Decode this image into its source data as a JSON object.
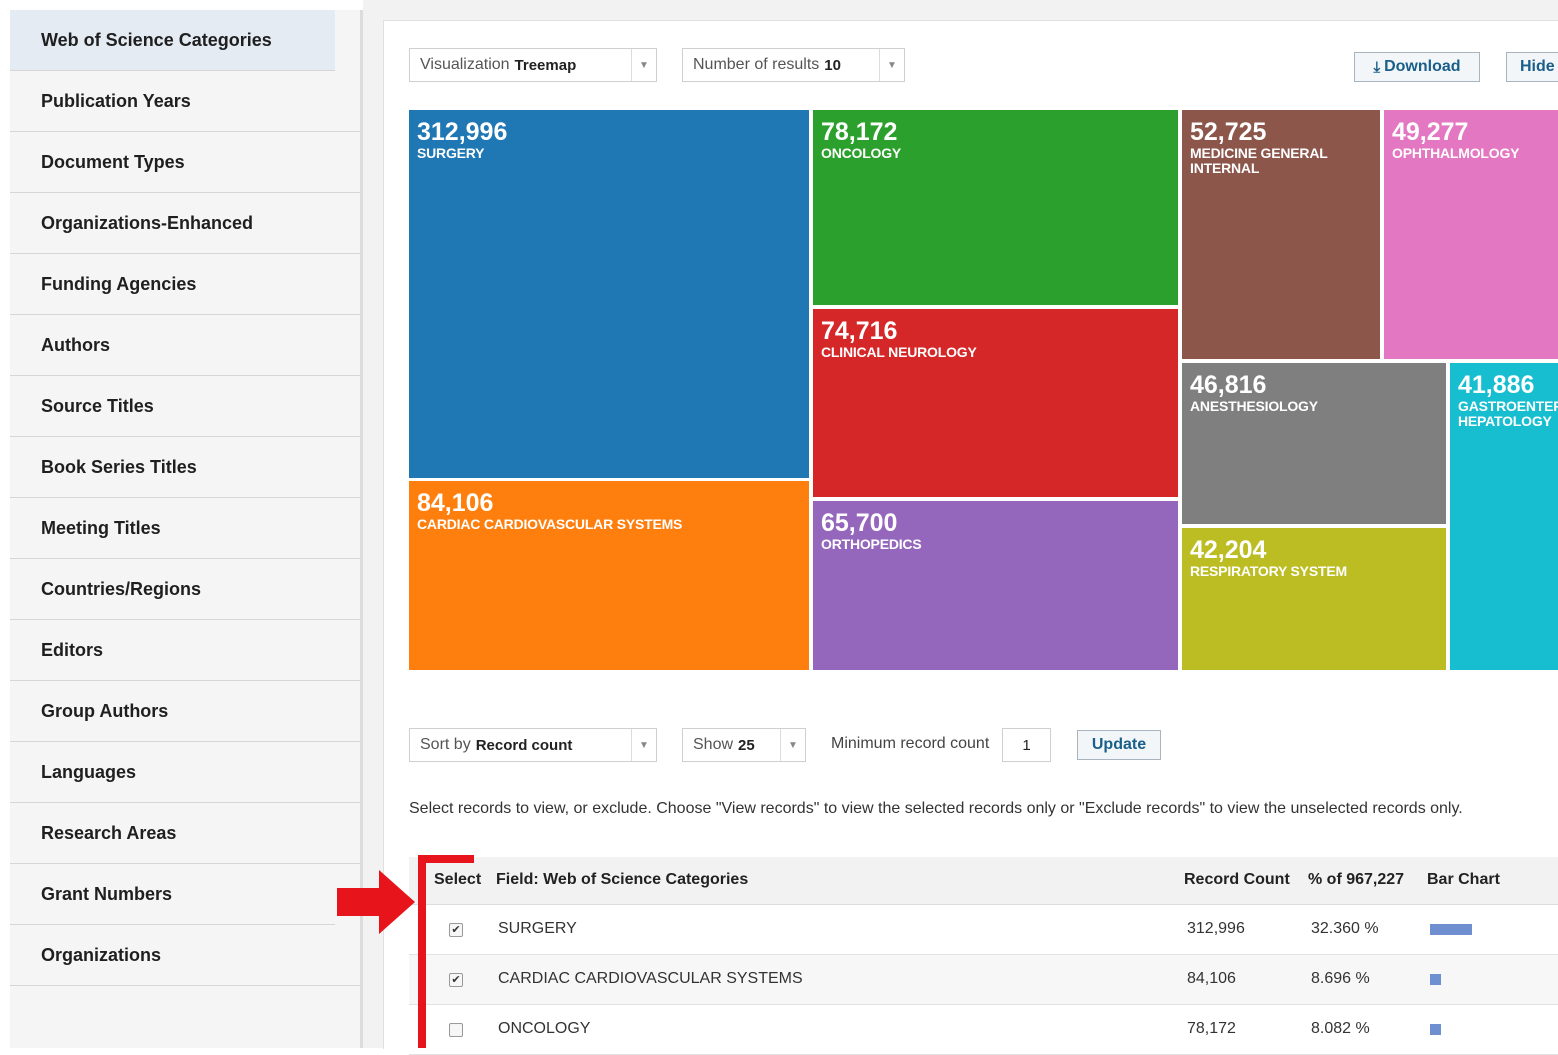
{
  "sidebar": {
    "items": [
      {
        "label": "Web of Science Categories"
      },
      {
        "label": "Publication Years"
      },
      {
        "label": "Document Types"
      },
      {
        "label": "Organizations-Enhanced"
      },
      {
        "label": "Funding Agencies"
      },
      {
        "label": "Authors"
      },
      {
        "label": "Source Titles"
      },
      {
        "label": "Book Series Titles"
      },
      {
        "label": "Meeting Titles"
      },
      {
        "label": "Countries/Regions"
      },
      {
        "label": "Editors"
      },
      {
        "label": "Group Authors"
      },
      {
        "label": "Languages"
      },
      {
        "label": "Research Areas"
      },
      {
        "label": "Grant Numbers"
      },
      {
        "label": "Organizations"
      }
    ]
  },
  "toolbar": {
    "visualization_label": "Visualization",
    "visualization_value": "Treemap",
    "results_label": "Number of results",
    "results_value": "10",
    "download_label": "Download",
    "hide_label": "Hide"
  },
  "chart_data": {
    "type": "treemap",
    "items": [
      {
        "value": 312996,
        "display": "312,996",
        "label": "SURGERY",
        "color": "#1f77b4"
      },
      {
        "value": 84106,
        "display": "84,106",
        "label": "CARDIAC CARDIOVASCULAR SYSTEMS",
        "color": "#ff7f0e"
      },
      {
        "value": 78172,
        "display": "78,172",
        "label": "ONCOLOGY",
        "color": "#2ca02c"
      },
      {
        "value": 74716,
        "display": "74,716",
        "label": "CLINICAL NEUROLOGY",
        "color": "#d62728"
      },
      {
        "value": 65700,
        "display": "65,700",
        "label": "ORTHOPEDICS",
        "color": "#9467bd"
      },
      {
        "value": 52725,
        "display": "52,725",
        "label": "MEDICINE GENERAL INTERNAL",
        "color": "#8c564b"
      },
      {
        "value": 49277,
        "display": "49,277",
        "label": "OPHTHALMOLOGY",
        "color": "#e377c2"
      },
      {
        "value": 46816,
        "display": "46,816",
        "label": "ANESTHESIOLOGY",
        "color": "#7f7f7f"
      },
      {
        "value": 42204,
        "display": "42,204",
        "label": "RESPIRATORY SYSTEM",
        "color": "#bcbd22"
      },
      {
        "value": 41886,
        "display": "41,886",
        "label": "GASTROENTEROLOGY HEPATOLOGY",
        "shown_label": "GASTROENTER HEPATOLOGY",
        "color": "#17becf"
      }
    ]
  },
  "controls": {
    "sort_label": "Sort by",
    "sort_value": "Record count",
    "show_label": "Show",
    "show_value": "25",
    "min_count_label": "Minimum record count",
    "min_count_value": "1",
    "update_label": "Update"
  },
  "instructions": "Select records to view, or exclude. Choose \"View records\" to view the selected records only or \"Exclude records\" to view the unselected records only.",
  "table": {
    "headers": {
      "select": "Select",
      "field": "Field: Web of Science Categories",
      "count": "Record Count",
      "percent": "% of 967,227",
      "bar": "Bar Chart"
    },
    "rows": [
      {
        "checked": true,
        "field": "SURGERY",
        "count": "312,996",
        "percent": "32.360 %",
        "bar_pct": 32.36
      },
      {
        "checked": true,
        "field": "CARDIAC CARDIOVASCULAR SYSTEMS",
        "count": "84,106",
        "percent": "8.696 %",
        "bar_pct": 8.696
      },
      {
        "checked": false,
        "field": "ONCOLOGY",
        "count": "78,172",
        "percent": "8.082 %",
        "bar_pct": 8.082
      }
    ]
  },
  "colors": {
    "annotation_red": "#e8141c",
    "link_blue": "#1a5f8a"
  }
}
